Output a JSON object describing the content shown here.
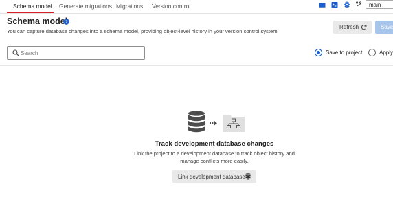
{
  "tabs": [
    {
      "label": "Schema model",
      "active": true
    },
    {
      "label": "Generate migrations",
      "active": false
    },
    {
      "label": "Migrations",
      "active": false
    },
    {
      "label": "Version control",
      "active": false
    }
  ],
  "toolbar": {
    "icons": [
      "folder-icon",
      "terminal-icon",
      "gear-icon",
      "branch-icon"
    ],
    "branch": "main"
  },
  "header": {
    "title": "Schema model",
    "subtitle": "You can capture database changes into a schema model, providing object-level history in your version control system.",
    "refresh_label": "Refresh",
    "save_label": "Save"
  },
  "search": {
    "placeholder": "Search",
    "value": ""
  },
  "radios": [
    {
      "label": "Save to project",
      "checked": true
    },
    {
      "label": "Apply",
      "checked": false
    }
  ],
  "empty_state": {
    "title": "Track development database changes",
    "description": "Link the project to a development database to track object history and manage conflicts more easily.",
    "button_label": "Link development database"
  },
  "colors": {
    "accent_blue": "#1a5fcc",
    "tab_underline": "#d71f26",
    "save_button_disabled": "#a7c5ea",
    "button_gray": "#e9e9e9",
    "icon_gray": "#5f6368"
  }
}
